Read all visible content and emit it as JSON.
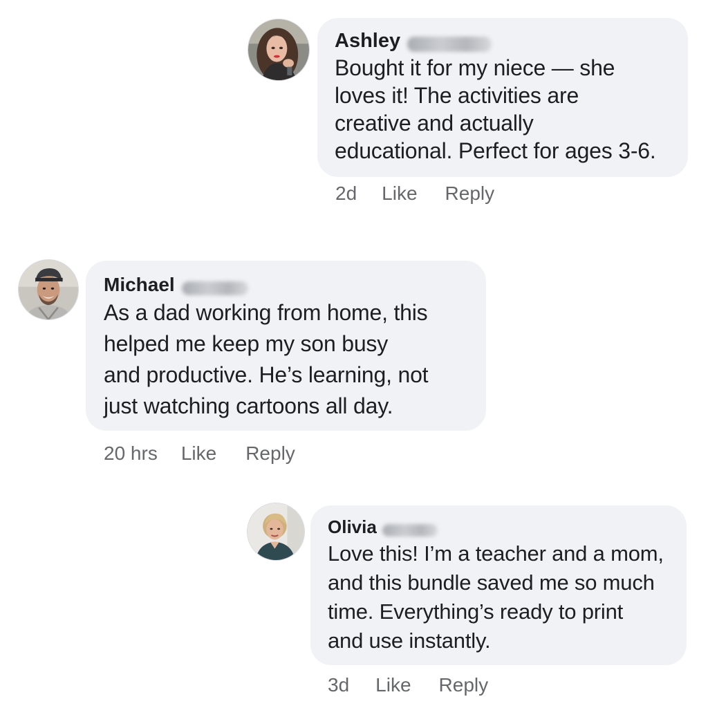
{
  "comments": [
    {
      "author": "Ashley",
      "author_surname_redacted": true,
      "text": "Bought it for my niece — she\nloves it! The activities are\ncreative and actually\neducational. Perfect for ages 3-6.",
      "time": "2d",
      "like_label": "Like",
      "reply_label": "Reply",
      "avatar": "ashley-avatar-photo"
    },
    {
      "author": "Michael",
      "author_surname_redacted": true,
      "text": "As a dad working from home, this\nhelped me keep my son busy\nand productive. He’s learning, not\njust watching cartoons all day.",
      "time": "20 hrs",
      "like_label": "Like",
      "reply_label": "Reply",
      "avatar": "michael-avatar-photo"
    },
    {
      "author": "Olivia",
      "author_surname_redacted": true,
      "text": "Love this! I’m a teacher and a mom,\nand this bundle saved me so much\ntime. Everything’s ready to print\nand use instantly.",
      "time": "3d",
      "like_label": "Like",
      "reply_label": "Reply",
      "avatar": "olivia-avatar-photo"
    }
  ],
  "colors": {
    "bubble_bg": "#f0f2f5",
    "text": "#1c1e21",
    "meta_text": "#65676b"
  }
}
